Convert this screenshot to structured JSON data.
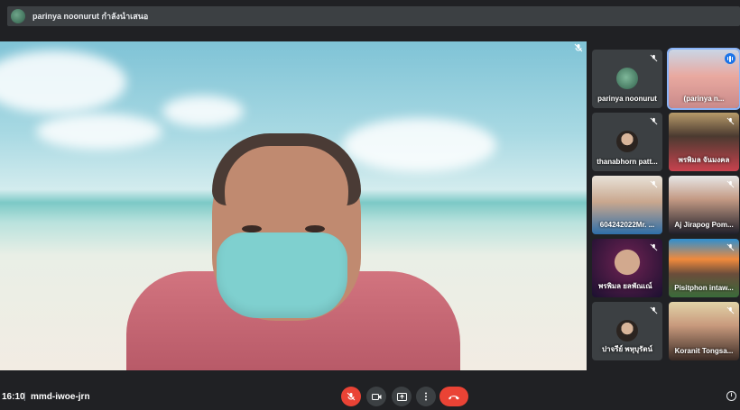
{
  "presenter_bar": {
    "text": "parinya noonurut กำลังนำเสนอ"
  },
  "participants": [
    {
      "name": "parinya noonurut",
      "muted": true,
      "video": false
    },
    {
      "name": "(parinya n...",
      "muted": false,
      "video": true,
      "speaking": true
    },
    {
      "name": "thanabhorn patt...",
      "muted": true,
      "video": false
    },
    {
      "name": "พรพิมล จันมงคล",
      "muted": true,
      "video": true
    },
    {
      "name": "604242022Mr. ...",
      "muted": true,
      "video": true
    },
    {
      "name": "Aj Jirapog Pom...",
      "muted": true,
      "video": true
    },
    {
      "name": "พรพิมล ยลพัณเณ์",
      "muted": true,
      "video": true
    },
    {
      "name": "Pisitphon intaw...",
      "muted": true,
      "video": true
    },
    {
      "name": "ปาจรีย์ พหุบุรัตน์",
      "muted": true,
      "video": false
    },
    {
      "name": "Koranit Tongsa...",
      "muted": true,
      "video": true
    }
  ],
  "bottom_bar": {
    "time": "16:10",
    "separator": "|",
    "meeting_code": "mmd-iwoe-jrn",
    "controls": [
      "mic-off-icon",
      "camera-icon",
      "present-icon",
      "more-icon",
      "end-call-icon"
    ],
    "info_icon": "i"
  },
  "colors": {
    "background": "#202124",
    "danger": "#ea4335",
    "accent": "#8ab4f8"
  }
}
